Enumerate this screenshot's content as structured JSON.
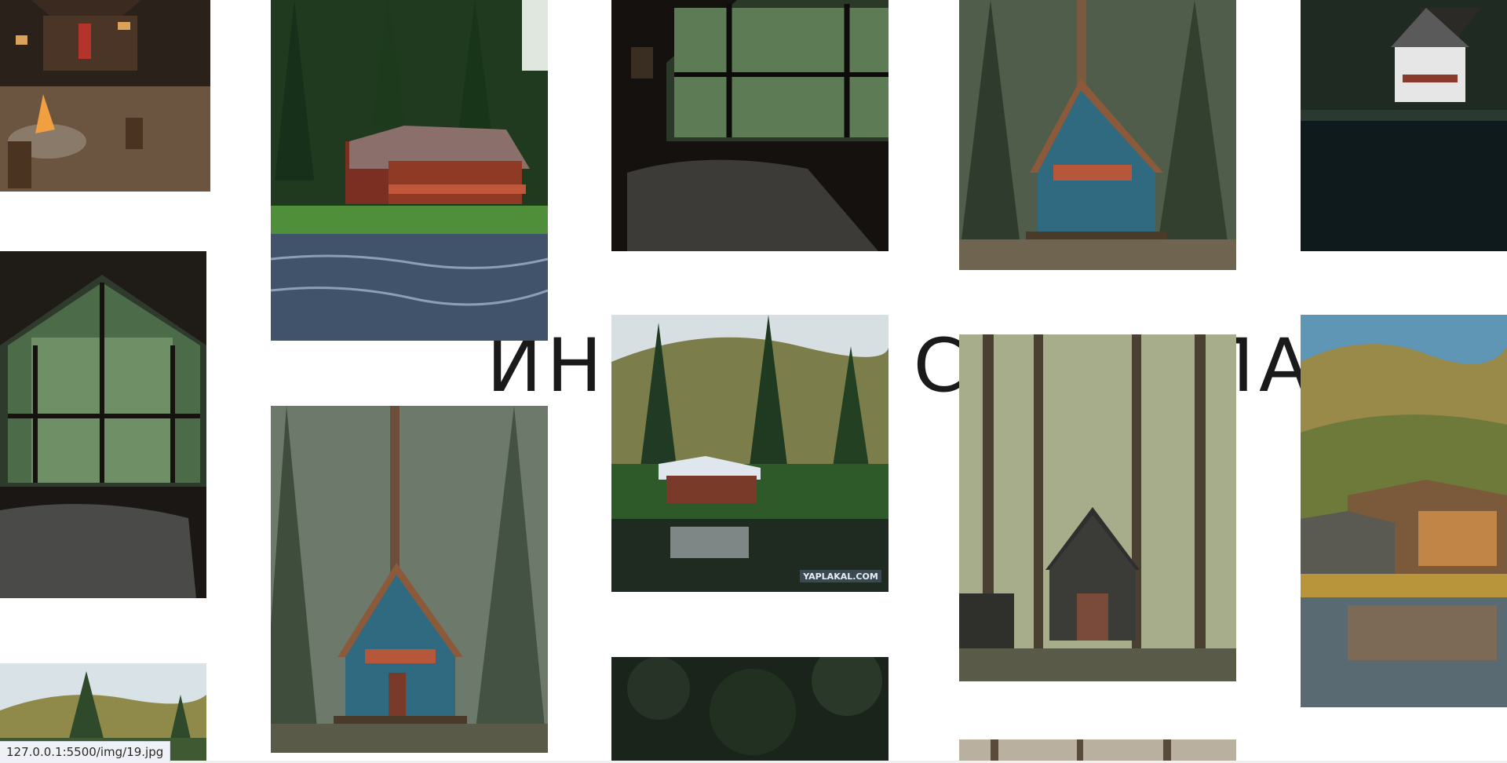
{
  "hero": {
    "title": "ИНЕРЦИЯ СКРОЛЛА"
  },
  "status_bar": {
    "url": "127.0.0.1:5500/img/19.jpg"
  },
  "gallery": {
    "watermark": "YAPLAKAL.COM",
    "photos": [
      {
        "id": "campfire-cabin",
        "subject": "dark cabin with campfire"
      },
      {
        "id": "river-cabin",
        "subject": "red cabin by river"
      },
      {
        "id": "bedroom-window",
        "subject": "dark bedroom with window"
      },
      {
        "id": "blue-aframe-1",
        "subject": "blue A-frame in forest"
      },
      {
        "id": "lake-house",
        "subject": "white house on dark lake"
      },
      {
        "id": "aframe-window",
        "subject": "A-frame window bedroom"
      },
      {
        "id": "blue-aframe-2",
        "subject": "blue A-frame in foggy forest"
      },
      {
        "id": "lake-cabin",
        "subject": "cabin at lake with reflection"
      },
      {
        "id": "dark-aframe",
        "subject": "dark A-frame in tall woods"
      },
      {
        "id": "mountain-lodge",
        "subject": "mountain lodge by lake"
      },
      {
        "id": "pine-peek",
        "subject": "pine forest"
      },
      {
        "id": "dark-foliage",
        "subject": "dark foliage"
      },
      {
        "id": "forest-strip",
        "subject": "forest trunks"
      }
    ]
  }
}
